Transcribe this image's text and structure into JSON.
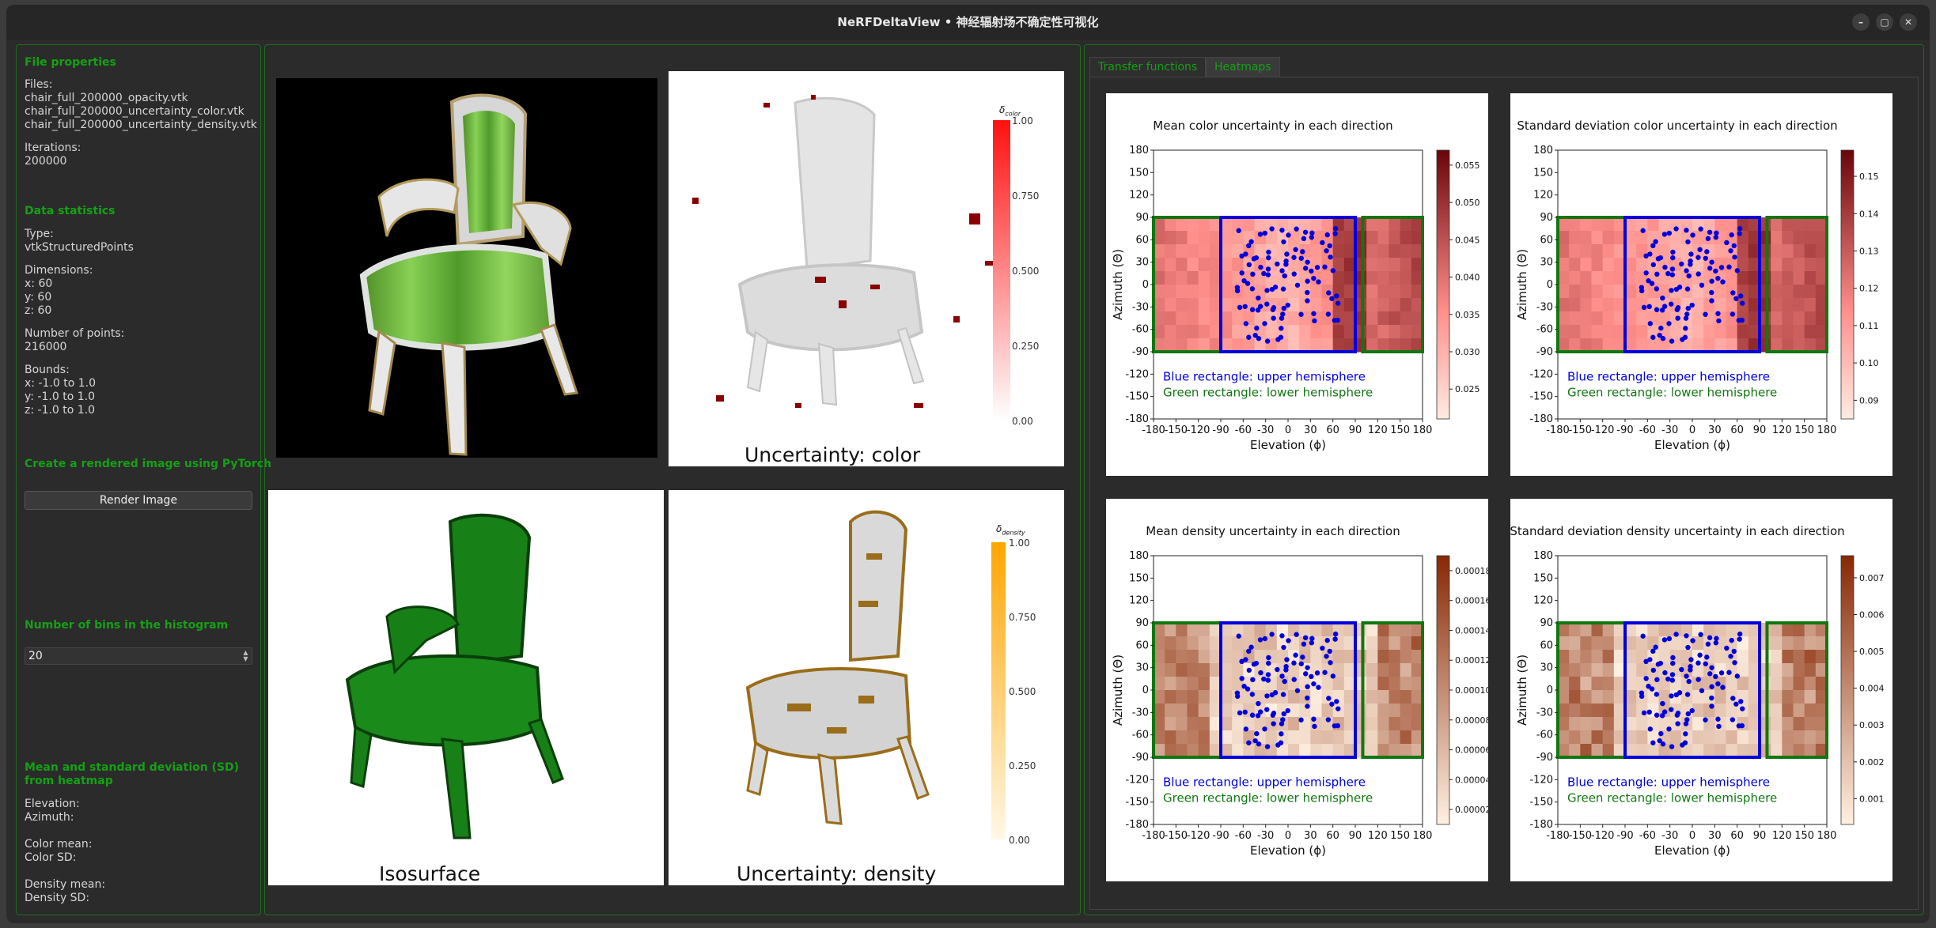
{
  "window": {
    "title": "NeRFDeltaView • 神经辐射场不确定性可视化",
    "buttons": {
      "minimize": "–",
      "maximize": "▢",
      "close": "✕"
    }
  },
  "left": {
    "file_properties": {
      "heading": "File properties",
      "files_label": "Files:",
      "files": [
        "chair_full_200000_opacity.vtk",
        "chair_full_200000_uncertainty_color.vtk",
        "chair_full_200000_uncertainty_density.vtk"
      ],
      "iterations_label": "Iterations:",
      "iterations": "200000"
    },
    "data_statistics": {
      "heading": "Data statistics",
      "type_label": "Type:",
      "type": "vtkStructuredPoints",
      "dimensions_label": "Dimensions:",
      "dim_x": "x: 60",
      "dim_y": "y: 60",
      "dim_z": "z: 60",
      "points_label": "Number of points:",
      "points": "216000",
      "bounds_label": "Bounds:",
      "bounds_x": "x: -1.0 to 1.0",
      "bounds_y": "y: -1.0 to 1.0",
      "bounds_z": "z: -1.0 to 1.0"
    },
    "render": {
      "heading": "Create a rendered image using PyTorch",
      "button": "Render Image"
    },
    "histogram": {
      "heading": "Number of bins in the histogram",
      "value": "20"
    },
    "heatmap_stats": {
      "heading_line1": "Mean and standard deviation (SD)",
      "heading_line2": "from heatmap",
      "elevation": "Elevation:",
      "azimuth": "Azimuth:",
      "color_mean": "Color mean:",
      "color_sd": "Color SD:",
      "density_mean": "Density mean:",
      "density_sd": "Density SD:"
    }
  },
  "views": {
    "color_label": "Uncertainty: color",
    "iso_label": "Isosurface",
    "density_label": "Uncertainty: density",
    "color_bar": {
      "title": "δ",
      "sub": "color",
      "ticks": [
        "1.00",
        "0.750",
        "0.500",
        "0.250",
        "0.00"
      ]
    },
    "density_bar": {
      "title": "δ",
      "sub": "density",
      "ticks": [
        "1.00",
        "0.750",
        "0.500",
        "0.250",
        "0.00"
      ]
    }
  },
  "tabs": {
    "items": [
      "Transfer functions",
      "Heatmaps"
    ],
    "active": "Heatmaps"
  },
  "heatmap_common": {
    "xlabel": "Elevation (ϕ)",
    "ylabel": "Azimuth (Θ)",
    "ticks": [
      "-180",
      "-150",
      "-120",
      "-90",
      "-60",
      "-30",
      "0",
      "30",
      "60",
      "90",
      "120",
      "150",
      "180"
    ],
    "ytick_labels": [
      "180",
      "150",
      "120",
      "90",
      "60",
      "30",
      "0",
      "-30",
      "-60",
      "-90",
      "-120",
      "-150",
      "-180"
    ],
    "xtick_labels": [
      "-180",
      "-150",
      "-120",
      "-90",
      "-60",
      "-30",
      "0",
      "30",
      "60",
      "90",
      "120",
      "150",
      "180"
    ],
    "legend_blue": "Blue rectangle: upper hemisphere",
    "legend_green": "Green rectangle: lower hemisphere",
    "colors": {
      "blue": "#0000dd",
      "green": "#117711"
    }
  },
  "chart_data": [
    {
      "type": "heatmap",
      "title": "Mean color uncertainty in each direction",
      "colormap": "Reds",
      "colorbar_ticks": [
        "0.055",
        "0.050",
        "0.045",
        "0.040",
        "0.035",
        "0.030",
        "0.025"
      ],
      "colorbar_range": [
        0.021,
        0.057
      ],
      "xlim": [
        -180,
        180
      ],
      "ylim": [
        -180,
        180
      ]
    },
    {
      "type": "heatmap",
      "title": "Standard deviation color uncertainty in each direction",
      "colormap": "Reds",
      "colorbar_ticks": [
        "0.15",
        "0.14",
        "0.13",
        "0.12",
        "0.11",
        "0.10",
        "0.09"
      ],
      "colorbar_range": [
        0.085,
        0.157
      ],
      "xlim": [
        -180,
        180
      ],
      "ylim": [
        -180,
        180
      ]
    },
    {
      "type": "heatmap",
      "title": "Mean density uncertainty in each direction",
      "colormap": "Oranges",
      "colorbar_ticks": [
        "0.00018",
        "0.00016",
        "0.00014",
        "0.00012",
        "0.00010",
        "0.00008",
        "0.00006",
        "0.00004",
        "0.00002"
      ],
      "colorbar_range": [
        1e-05,
        0.00019
      ],
      "xlim": [
        -180,
        180
      ],
      "ylim": [
        -180,
        180
      ]
    },
    {
      "type": "heatmap",
      "title": "Standard deviation density uncertainty in each direction",
      "colormap": "Oranges",
      "colorbar_ticks": [
        "0.007",
        "0.006",
        "0.005",
        "0.004",
        "0.003",
        "0.002",
        "0.001"
      ],
      "colorbar_range": [
        0.0003,
        0.0076
      ],
      "xlim": [
        -180,
        180
      ],
      "ylim": [
        -180,
        180
      ]
    }
  ]
}
